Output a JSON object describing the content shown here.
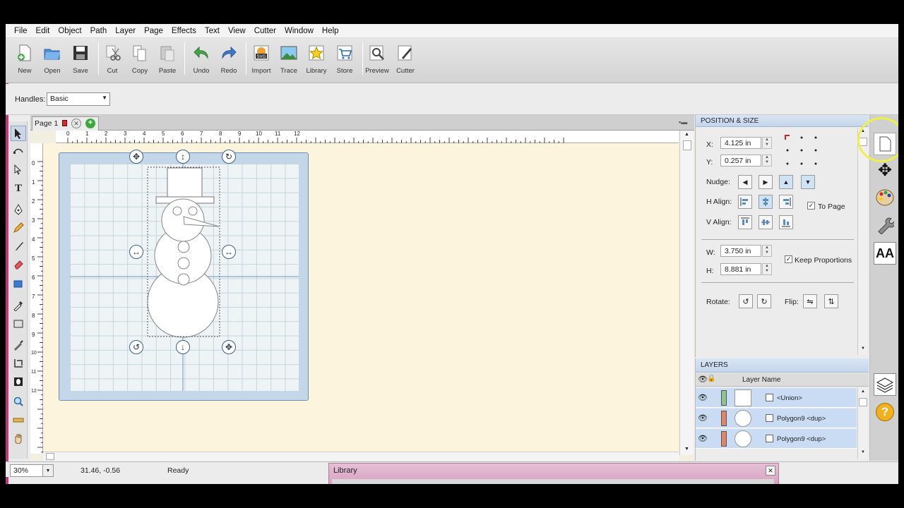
{
  "menu": [
    "File",
    "Edit",
    "Object",
    "Path",
    "Layer",
    "Page",
    "Effects",
    "Text",
    "View",
    "Cutter",
    "Window",
    "Help"
  ],
  "toolbar": {
    "new": "New",
    "open": "Open",
    "save": "Save",
    "cut": "Cut",
    "copy": "Copy",
    "paste": "Paste",
    "undo": "Undo",
    "redo": "Redo",
    "import": "Import",
    "trace": "Trace",
    "library": "Library",
    "store": "Store",
    "preview": "Preview",
    "cutter": "Cutter"
  },
  "handles": {
    "label": "Handles:",
    "value": "Basic"
  },
  "document": {
    "tab_label": "Page 1"
  },
  "ruler_h": [
    "0",
    "1",
    "2",
    "3",
    "4",
    "5",
    "6",
    "7",
    "8",
    "9",
    "10",
    "11",
    "12"
  ],
  "ruler_v": [
    "0",
    "1",
    "2",
    "3",
    "4",
    "5",
    "6",
    "7",
    "8",
    "9",
    "10",
    "11",
    "12"
  ],
  "position_size": {
    "title": "POSITION & SIZE",
    "x_label": "X:",
    "x_value": "4.125 in",
    "y_label": "Y:",
    "y_value": "0.257 in",
    "nudge_label": "Nudge:",
    "h_align_label": "H Align:",
    "v_align_label": "V Align:",
    "to_page_label": "To Page",
    "w_label": "W:",
    "w_value": "3.750 in",
    "h_label": "H:",
    "h_value": "8.881 in",
    "keep_proportions_label": "Keep Proportions",
    "rotate_label": "Rotate:",
    "flip_label": "Flip:"
  },
  "layers": {
    "title": "LAYERS",
    "column_header": "Layer Name",
    "rows": [
      {
        "name": "<Union>",
        "color": "#8fc48f"
      },
      {
        "name": "Polygon9 <dup>",
        "color": "#e0846a"
      },
      {
        "name": "Polygon9 <dup>",
        "color": "#e0846a"
      }
    ]
  },
  "status": {
    "zoom": "30%",
    "coords": "31.46, -0.56",
    "state": "Ready"
  },
  "library_window": {
    "title": "Library"
  }
}
